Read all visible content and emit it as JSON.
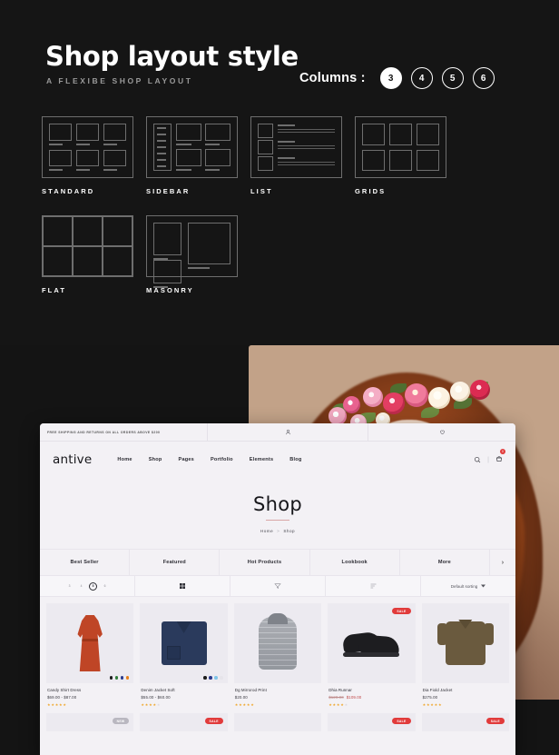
{
  "hero": {
    "title": "Shop layout style",
    "subtitle": "A FLEXIBE SHOP LAYOUT",
    "columns_label": "Columns :",
    "columns_options": [
      "3",
      "4",
      "5",
      "6"
    ],
    "columns_active": "3"
  },
  "layouts": [
    {
      "label": "STANDARD",
      "kind": "standard"
    },
    {
      "label": "SIDEBAR",
      "kind": "sidebar"
    },
    {
      "label": "LIST",
      "kind": "list"
    },
    {
      "label": "GRIDS",
      "kind": "grids"
    },
    {
      "label": "FLAT",
      "kind": "flat"
    },
    {
      "label": "MASONRY",
      "kind": "masonry"
    }
  ],
  "site": {
    "promo": "FREE SHIPPING AND RETURNS ON ALL ORDERS ABOVE $200",
    "logo": "antive",
    "nav": [
      "Home",
      "Shop",
      "Pages",
      "Portfolio",
      "Elements",
      "Blog"
    ],
    "account_icon": "user-icon",
    "wishlist_icon": "heart-icon",
    "search_icon": "search-icon",
    "cart_icon": "cart-icon",
    "cart_count": "0"
  },
  "page": {
    "title": "Shop",
    "breadcrumb": [
      "Home",
      "Shop"
    ],
    "breadcrumb_sep": ">"
  },
  "category_tabs": [
    "Best Seller",
    "Featured",
    "Hot Products",
    "Lookbook",
    "More"
  ],
  "tabs_next_icon": "chevron-right-icon",
  "toolbar": {
    "columns": [
      "3",
      "4",
      "5",
      "6"
    ],
    "columns_active": "5",
    "grid_icon": "grid-view-icon",
    "filter_icon": "filter-funnel-icon",
    "list_icon": "list-view-icon",
    "sort_label": "Default sorting",
    "sort_caret": "caret-down-icon"
  },
  "products": [
    {
      "name": "Candy Shirt Dress",
      "price": "$69.00 - $87.00",
      "old_price": "",
      "rating": 5,
      "badge": "",
      "swatches": [
        "#1c1c1c",
        "#2f7d3a",
        "#2a3a8c",
        "#e8821a"
      ]
    },
    {
      "name": "Denim Jacket Soft",
      "price": "$55.00 - $60.00",
      "old_price": "",
      "rating": 4,
      "badge": "",
      "swatches": [
        "#1c1c1c",
        "#2a3a8c",
        "#7fc4e8",
        "#e6e4ea"
      ]
    },
    {
      "name": "Dg Mirrorod Print",
      "price": "$20.00",
      "old_price": "",
      "rating": 5,
      "badge": "",
      "swatches": []
    },
    {
      "name": "Dhia Runnar",
      "price": "$109.00",
      "old_price": "$120.00",
      "rating": 4,
      "badge": "SALE",
      "swatches": []
    },
    {
      "name": "Dia Fiold Jacket",
      "price": "$275.00",
      "old_price": "",
      "rating": 5,
      "badge": "",
      "swatches": []
    }
  ],
  "products_row2": [
    {
      "badge": "NEW",
      "badge_kind": "new"
    },
    {
      "badge": "SALE",
      "badge_kind": "sale"
    },
    {
      "badge": "",
      "badge_kind": ""
    },
    {
      "badge": "SALE",
      "badge_kind": "sale"
    },
    {
      "badge": "SALE",
      "badge_kind": "sale"
    }
  ],
  "colors": {
    "panel_bg": "#151515",
    "accent_pink": "#d9a6a6",
    "sale_red": "#e13b3b",
    "star_gold": "#f0a629",
    "mock_bg": "#f3f1f5"
  }
}
